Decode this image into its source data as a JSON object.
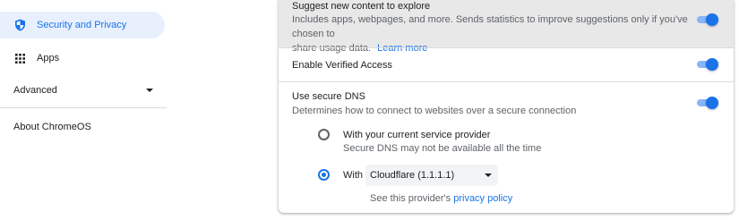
{
  "sidebar": {
    "items": [
      {
        "label": "Security and Privacy",
        "icon": "shield-icon",
        "selected": true
      },
      {
        "label": "Apps",
        "icon": "apps-grid-icon",
        "selected": false
      }
    ],
    "advanced_label": "Advanced",
    "about_label": "About ChromeOS"
  },
  "settings": {
    "suggest": {
      "title": "Suggest new content to explore",
      "description": "Includes apps, webpages, and more. Sends statistics to improve suggestions only if you've chosen to",
      "description_line2": "share usage data.",
      "learn_more": "Learn more",
      "enabled": true
    },
    "verified_access": {
      "title": "Enable Verified Access",
      "enabled": true
    },
    "secure_dns": {
      "title": "Use secure DNS",
      "description": "Determines how to connect to websites over a secure connection",
      "enabled": true,
      "option_current": {
        "label": "With your current service provider",
        "sublabel": "Secure DNS may not be available all the time",
        "checked": false
      },
      "option_custom": {
        "label": "With",
        "checked": true,
        "provider": "Cloudflare (1.1.1.1)"
      },
      "policy_prefix": "See this provider's",
      "policy_link": "privacy policy"
    }
  },
  "colors": {
    "accent": "#1a73e8",
    "selected_bg": "#e8f0fe",
    "highlight_row": "#e8e8e8"
  }
}
